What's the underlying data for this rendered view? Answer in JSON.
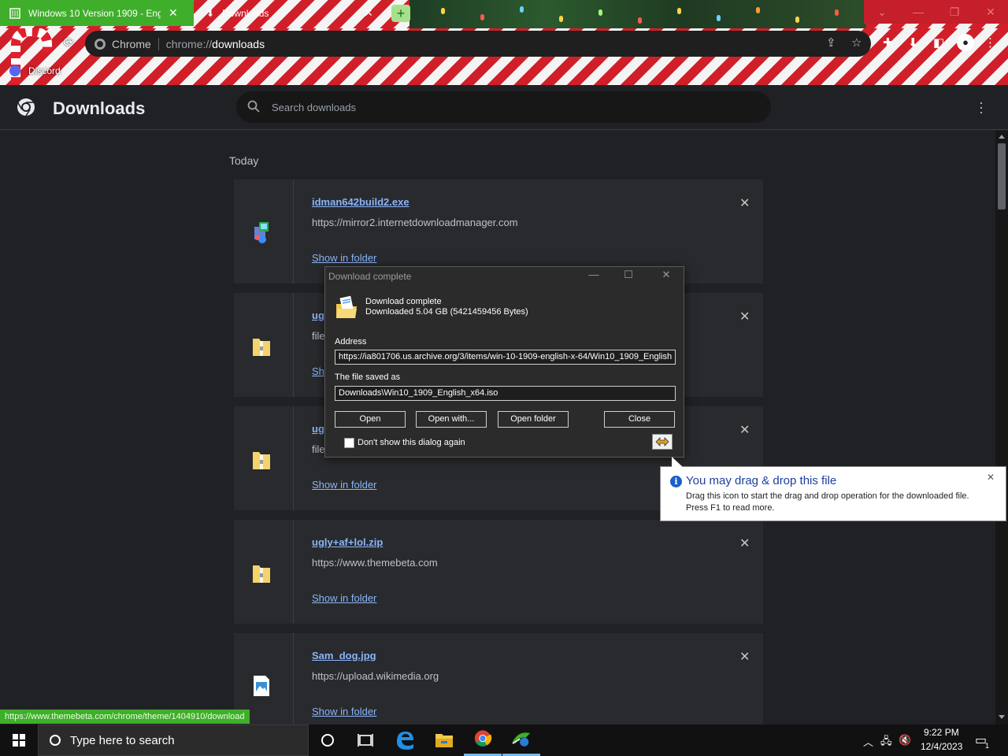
{
  "tabs": [
    {
      "title": "Windows 10 Version 1909 - Eng",
      "active": true
    },
    {
      "title": "Downloads",
      "active": false
    }
  ],
  "omnibox": {
    "scheme_label": "Chrome",
    "url_prefix": "chrome://",
    "url_host": "downloads"
  },
  "bookmarks": [
    {
      "label": "Discord"
    }
  ],
  "page": {
    "title": "Downloads",
    "search_placeholder": "Search downloads",
    "date_header": "Today"
  },
  "downloads": [
    {
      "filename": "idman642build2.exe",
      "url": "https://mirror2.internetdownloadmanager.com",
      "action": "Show in folder",
      "icon": "installer-icon"
    },
    {
      "filename": "ug",
      "url": "file",
      "action": "Sh",
      "icon": "zip-icon"
    },
    {
      "filename": "ug",
      "url": "file",
      "action": "Show in folder",
      "icon": "zip-icon"
    },
    {
      "filename": "ugly+af+lol.zip",
      "url": "https://www.themebeta.com",
      "action": "Show in folder",
      "icon": "zip-icon"
    },
    {
      "filename": "Sam_dog.jpg",
      "url": "https://upload.wikimedia.org",
      "action": "Show in folder",
      "icon": "image-icon"
    }
  ],
  "status_url": "https://www.themebeta.com/chrome/theme/1404910/download",
  "dialog": {
    "title": "Download complete",
    "heading": "Download complete",
    "summary": "Downloaded 5.04  GB (5421459456 Bytes)",
    "address_label": "Address",
    "address_value": "https://ia801706.us.archive.org/3/items/win-10-1909-english-x-64/Win10_1909_English",
    "saved_label": "The file saved as",
    "saved_value": "Downloads\\Win10_1909_English_x64.iso",
    "btn_open": "Open",
    "btn_open_with": "Open with...",
    "btn_open_folder": "Open folder",
    "btn_close": "Close",
    "checkbox_label": "Don't show this dialog again",
    "checkbox_checked": false
  },
  "tooltip": {
    "title": "You may drag & drop this file",
    "line1": "Drag this icon to start the drag and drop operation for the downloaded file.",
    "line2": "Press F1 to read more."
  },
  "taskbar": {
    "search_placeholder": "Type here to search",
    "time": "9:22 PM",
    "date": "12/4/2023",
    "notification_count": "1"
  },
  "colors": {
    "tab_active": "#3fae2a",
    "link": "#8ab4f8",
    "page_bg": "#202124",
    "card_bg": "#292a2d"
  }
}
